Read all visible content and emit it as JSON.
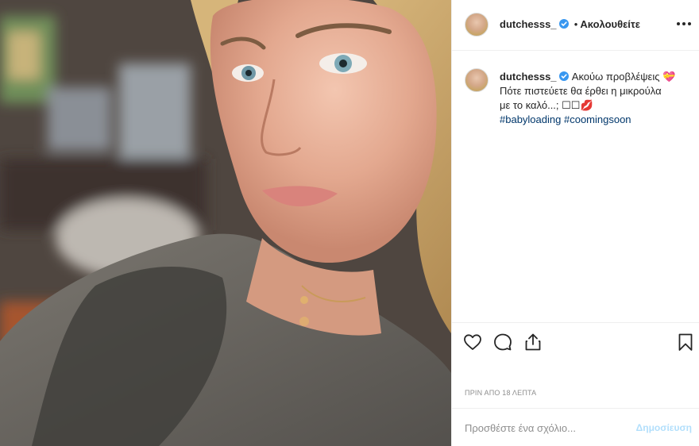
{
  "post": {
    "username": "dutchesss_",
    "verified": true,
    "separator": "•",
    "follow_status": "Ακολουθείτε",
    "caption": {
      "username": "dutchesss_",
      "line1": "Ακούω προβλέψεις 💝",
      "line2": "Πότε πιστεύετε θα έρθει η μικρούλα",
      "line3": "με το καλό...; ☐☐💋",
      "hashtags": [
        "#babyloading",
        "#coomingsoon"
      ]
    },
    "timestamp": "ΠΡΙΝ ΑΠΟ 18 ΛΕΠΤΑ",
    "comment": {
      "placeholder": "Προσθέστε ένα σχόλιο...",
      "post_label": "Δημοσίευση"
    }
  },
  "icons": {
    "more": "more-options-icon",
    "like": "heart-icon",
    "comment": "comment-icon",
    "share": "share-icon",
    "save": "bookmark-icon",
    "verified": "verified-badge-icon"
  },
  "colors": {
    "verified_blue": "#3897f0",
    "hashtag": "#00376b",
    "timestamp": "#8e8e8e",
    "post_button_disabled": "#b2dffc"
  }
}
